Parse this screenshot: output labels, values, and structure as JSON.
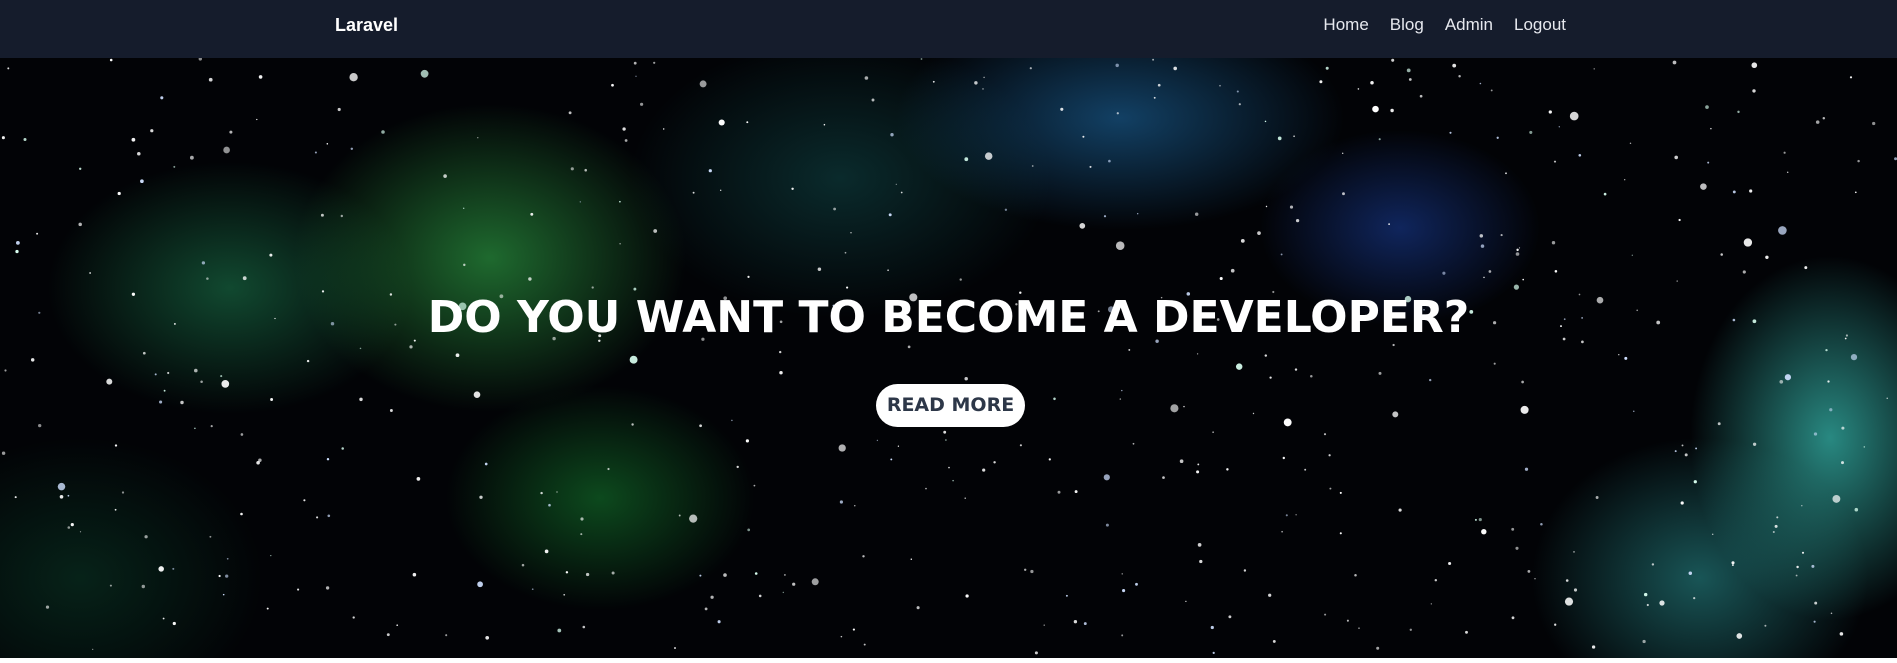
{
  "navbar": {
    "brand": "Laravel",
    "links": [
      {
        "label": "Home"
      },
      {
        "label": "Blog"
      },
      {
        "label": "Admin"
      },
      {
        "label": "Logout"
      }
    ],
    "background_color": "#151c2c"
  },
  "hero": {
    "title": "DO YOU WANT TO BECOME A DEVELOPER?",
    "button_label": "READ MORE",
    "background": "starfield-nebula"
  }
}
